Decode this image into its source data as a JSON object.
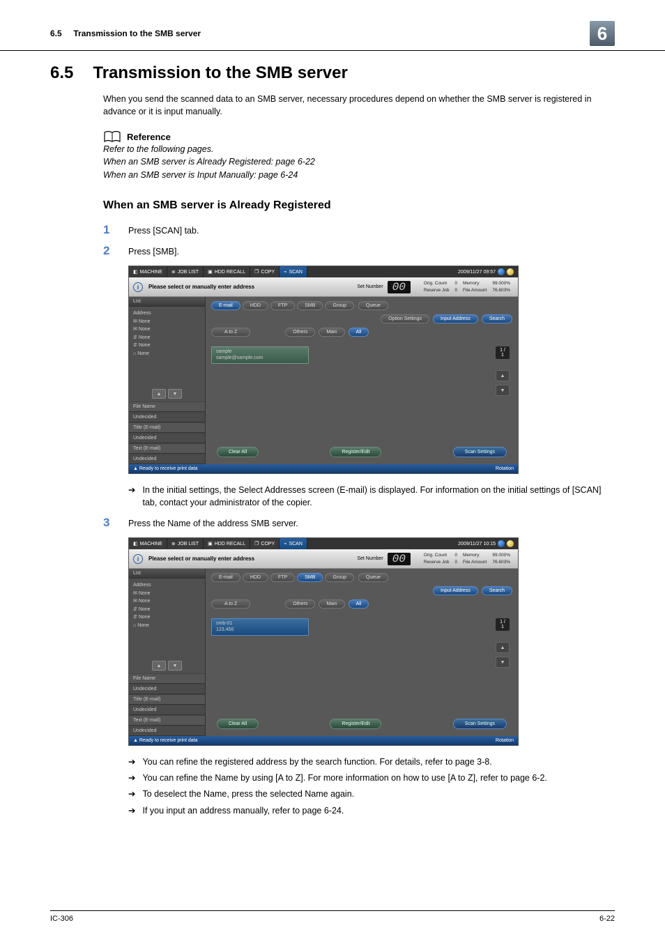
{
  "header": {
    "section": "6.5",
    "sectionTitle": "Transmission to the SMB server",
    "chapterBadge": "6"
  },
  "title": {
    "num": "6.5",
    "text": "Transmission to the SMB server"
  },
  "intro": "When you send the scanned data to an SMB server, necessary procedures depend on whether the SMB server is registered in advance or it is input manually.",
  "reference": {
    "label": "Reference",
    "line1": "Refer to the following pages.",
    "line2": "When an SMB server is Already Registered: page 6-22",
    "line3": "When an SMB server is Input Manually: page 6-24"
  },
  "sub1": {
    "title": "When an SMB server is Already Registered",
    "step1": "Press [SCAN] tab.",
    "step2": "Press [SMB].",
    "noteAfterShot1": "In the initial settings, the Select Addresses screen (E-mail) is displayed.  For information on the initial settings of [SCAN] tab, contact your administrator of the copier.",
    "step3": "Press the Name of the address SMB server.",
    "bul1": "You can refine the registered address by the search function. For details, refer to page 3-8.",
    "bul2": "You can refine the Name by using [A to Z]. For more information on how to use [A to Z], refer to page 6-2.",
    "bul3": "To deselect the Name, press the selected Name again.",
    "bul4": "If you input an address manually, refer to page 6-24."
  },
  "ui": {
    "tabs": {
      "machine": "MACHINE",
      "joblist": "JOB LIST",
      "hddrecall": "HDD RECALL",
      "copy": "COPY",
      "scan": "SCAN"
    },
    "time1": "2009/11/27 09:57",
    "time2": "2009/11/27 10:15",
    "infoMsg": "Please select or manually enter address",
    "setNumber": "Set Number",
    "counter": "00",
    "stats": {
      "l1a": "Orig. Count",
      "l1b": "0",
      "l1c": "Memory",
      "l1d": "99.000%",
      "l2a": "Reserve Job",
      "l2b": "0",
      "l2c": "File Amount",
      "l2d": "76.603%"
    },
    "leftHeader": "List",
    "addressLabel": "Address",
    "none": "None",
    "fileName": "File Name",
    "undecided": "Undecided",
    "titleEmail": "Title (E-mail)",
    "textEmail": "Text (E-mail)",
    "protoTabs": {
      "email": "E-mail",
      "hdd": "HDD",
      "ftp": "FTP",
      "smb": "SMB",
      "group": "Group",
      "queue": "Queue"
    },
    "buttons": {
      "optSettings": "Option Settings",
      "inputAddr": "Input Address",
      "search": "Search",
      "atoz": "A to Z",
      "others": "Others",
      "main": "Main",
      "all": "All",
      "clearAll": "Clear All",
      "regEdit": "Register/Edit",
      "scanSettings": "Scan Settings"
    },
    "entry1": {
      "l1": "sample",
      "l2": "sample@sample.com"
    },
    "entry2": {
      "l1": "smb-01",
      "l2": "123.456"
    },
    "pageInd": "1 / 1",
    "statusBar": "Ready to receive print data",
    "rotation": "Rotation"
  },
  "footer": {
    "left": "IC-306",
    "right": "6-22"
  },
  "arrow": "➔",
  "tri": "▲",
  "triD": "▼"
}
